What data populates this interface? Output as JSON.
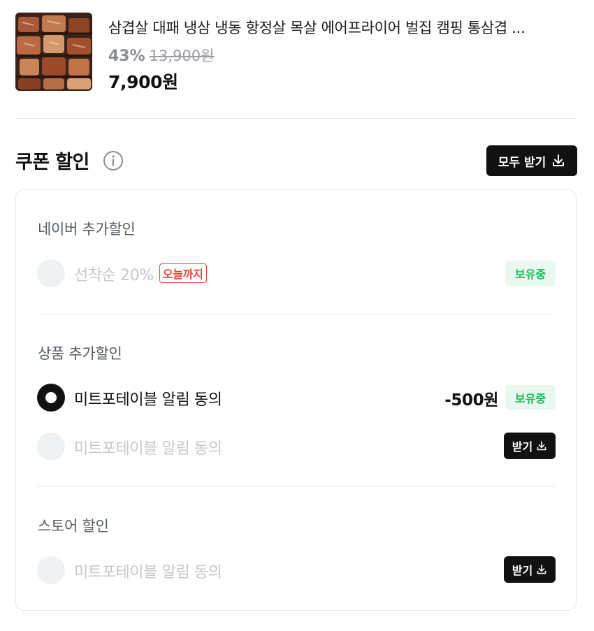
{
  "product": {
    "thumbnail_alt": "grilled pork belly",
    "title": "삼겹살 대패 냉삼 냉동 항정살 목살 에어프라이어 벌집 캠핑 통삼겹 ...",
    "discount_rate": "43%",
    "original_price": "13,900원",
    "final_price": "7,900원"
  },
  "coupon": {
    "title": "쿠폰 할인",
    "info_icon": "info-circle-icon",
    "download_all_label": "모두 받기",
    "download_icon": "download-icon"
  },
  "sections": [
    {
      "title": "네이버 추가할인",
      "rows": [
        {
          "label": "선착순 20%",
          "tag": "오늘까지",
          "status": "보유중",
          "selected": false
        }
      ]
    },
    {
      "title": "상품 추가할인",
      "rows": [
        {
          "label": "미트포테이블 알림 동의",
          "amount": "-500원",
          "status": "보유중",
          "selected": true
        },
        {
          "label": "미트포테이블 알림 동의",
          "action": "받기",
          "selected": false
        }
      ]
    },
    {
      "title": "스토어 할인",
      "rows": [
        {
          "label": "미트포테이블 알림 동의",
          "action": "받기",
          "selected": false
        }
      ]
    }
  ],
  "colors": {
    "accent_black": "#111111",
    "owned_green": "#22b85c",
    "owned_bg": "#e9f9ef",
    "deadline_red": "#e8432f",
    "muted_text": "#c4c7cc"
  }
}
